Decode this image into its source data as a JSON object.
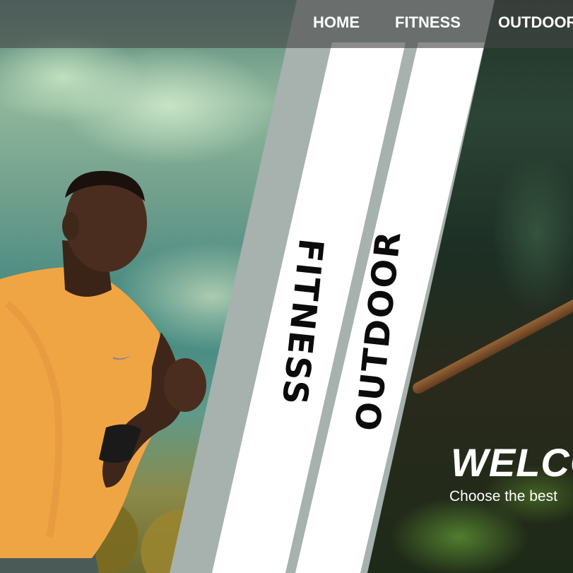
{
  "nav": {
    "items": [
      {
        "label": "HOME"
      },
      {
        "label": "FITNESS"
      },
      {
        "label": "OUTDOOR"
      }
    ]
  },
  "categories": {
    "fitness": "FITNESS",
    "outdoor": "OUTDOOR"
  },
  "hero": {
    "title": "WELCOME",
    "subtitle": "Choose the best"
  },
  "colors": {
    "band_white": "#ffffff",
    "band_gray": "#a7b1ad",
    "nav_bg": "#464646",
    "text_dark": "#0b0b0b",
    "text_light": "#ffffff",
    "shirt_orange": "#f0a545"
  },
  "icons": {
    "brand_mark": "swoosh-icon"
  }
}
